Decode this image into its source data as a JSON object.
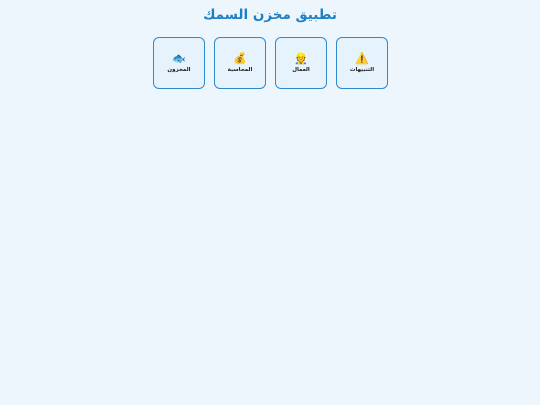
{
  "app": {
    "title": "تطبيق مخزن السمك"
  },
  "tiles": [
    {
      "id": "alerts",
      "label": "التنبيهات",
      "icon": "warning-icon",
      "glyph": "⚠️"
    },
    {
      "id": "workers",
      "label": "العمال",
      "icon": "construction-worker-icon",
      "glyph": "👷"
    },
    {
      "id": "accounting",
      "label": "المحاسبة",
      "icon": "money-bag-icon",
      "glyph": "💰"
    },
    {
      "id": "inventory",
      "label": "المخزون",
      "icon": "fish-icon",
      "glyph": "🐟"
    }
  ],
  "colors": {
    "background": "#eef6fd",
    "accent": "#1f7fc4",
    "tile_border": "#2d8ad0"
  }
}
